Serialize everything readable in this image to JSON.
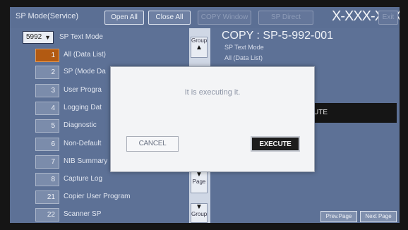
{
  "header": {
    "title": "SP Mode(Service)",
    "open_all": "Open All",
    "close_all": "Close All",
    "copy_window": "COPY Window",
    "sp_direct": "SP Direct",
    "model": "X-XXX-XXX",
    "exit": "Exit"
  },
  "left": {
    "select_value": "5992",
    "select_title": "SP Text Mode",
    "items": [
      {
        "num": "1",
        "label": "All (Data List)"
      },
      {
        "num": "2",
        "label": "SP (Mode Da"
      },
      {
        "num": "3",
        "label": "User Progra"
      },
      {
        "num": "4",
        "label": "Logging Dat"
      },
      {
        "num": "5",
        "label": "Diagnostic"
      },
      {
        "num": "6",
        "label": "Non-Default"
      },
      {
        "num": "7",
        "label": "NIB Summary"
      },
      {
        "num": "8",
        "label": "Capture Log"
      },
      {
        "num": "21",
        "label": "Copier User Program"
      },
      {
        "num": "22",
        "label": "Scanner SP"
      }
    ]
  },
  "scroll": {
    "group": "Group",
    "page": "Page"
  },
  "right": {
    "code": "COPY : SP-5-992-001",
    "sub1": "SP Text Mode",
    "sub2": "All (Data List)",
    "execute_bg": "UTE",
    "prev_page": "Prev.Page",
    "next_page": "Next Page"
  },
  "modal": {
    "message": "It is executing it.",
    "cancel": "CANCEL",
    "execute": "EXECUTE"
  }
}
